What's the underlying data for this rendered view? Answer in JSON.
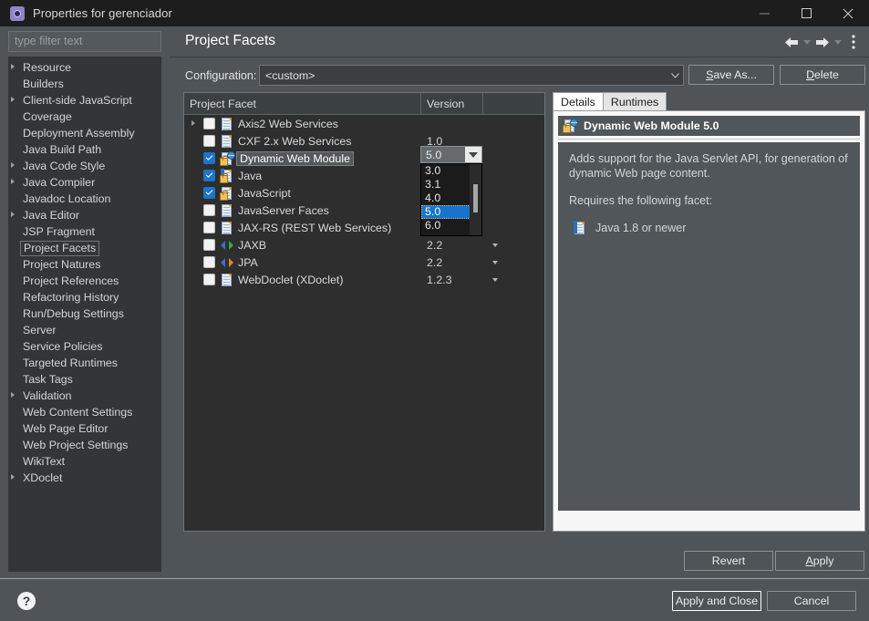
{
  "window": {
    "title": "Properties for gerenciador",
    "icon": "properties-gear-icon",
    "minimize": "—",
    "maximize": "□",
    "close": "✕"
  },
  "sidebar": {
    "filter_placeholder": "type filter text",
    "filter_value": "",
    "items": [
      {
        "label": "Resource",
        "expandable": true,
        "selected": false
      },
      {
        "label": "Builders",
        "expandable": false,
        "selected": false
      },
      {
        "label": "Client-side JavaScript",
        "expandable": true,
        "selected": false
      },
      {
        "label": "Coverage",
        "expandable": false,
        "selected": false
      },
      {
        "label": "Deployment Assembly",
        "expandable": false,
        "selected": false
      },
      {
        "label": "Java Build Path",
        "expandable": false,
        "selected": false
      },
      {
        "label": "Java Code Style",
        "expandable": true,
        "selected": false
      },
      {
        "label": "Java Compiler",
        "expandable": true,
        "selected": false
      },
      {
        "label": "Javadoc Location",
        "expandable": false,
        "selected": false
      },
      {
        "label": "Java Editor",
        "expandable": true,
        "selected": false
      },
      {
        "label": "JSP Fragment",
        "expandable": false,
        "selected": false
      },
      {
        "label": "Project Facets",
        "expandable": false,
        "selected": true
      },
      {
        "label": "Project Natures",
        "expandable": false,
        "selected": false
      },
      {
        "label": "Project References",
        "expandable": false,
        "selected": false
      },
      {
        "label": "Refactoring History",
        "expandable": false,
        "selected": false
      },
      {
        "label": "Run/Debug Settings",
        "expandable": false,
        "selected": false
      },
      {
        "label": "Server",
        "expandable": false,
        "selected": false
      },
      {
        "label": "Service Policies",
        "expandable": false,
        "selected": false
      },
      {
        "label": "Targeted Runtimes",
        "expandable": false,
        "selected": false
      },
      {
        "label": "Task Tags",
        "expandable": false,
        "selected": false
      },
      {
        "label": "Validation",
        "expandable": true,
        "selected": false
      },
      {
        "label": "Web Content Settings",
        "expandable": false,
        "selected": false
      },
      {
        "label": "Web Page Editor",
        "expandable": false,
        "selected": false
      },
      {
        "label": "Web Project Settings",
        "expandable": false,
        "selected": false
      },
      {
        "label": "WikiText",
        "expandable": false,
        "selected": false
      },
      {
        "label": "XDoclet",
        "expandable": true,
        "selected": false
      }
    ]
  },
  "page": {
    "title": "Project Facets",
    "tools": [
      {
        "name": "back-icon"
      },
      {
        "name": "back-dropdown-icon"
      },
      {
        "name": "forward-icon"
      },
      {
        "name": "forward-dropdown-icon"
      },
      {
        "name": "view-menu-icon"
      }
    ]
  },
  "configuration": {
    "label": "Configuration:",
    "value": "<custom>",
    "save_as_pre": "S",
    "save_as_post": "ave As...",
    "delete_pre": "D",
    "delete_post": "elete"
  },
  "facet_table": {
    "columns": [
      "Project Facet",
      "Version",
      ""
    ],
    "rows": [
      {
        "name": "Axis2 Web Services",
        "version": "",
        "checked": false,
        "expandable": true,
        "selected": false,
        "icon": "document-icon",
        "caret": false
      },
      {
        "name": "CXF 2.x Web Services",
        "version": "1.0",
        "checked": false,
        "expandable": false,
        "selected": false,
        "icon": "document-icon",
        "caret": false
      },
      {
        "name": "Dynamic Web Module",
        "version": "5.0",
        "checked": true,
        "expandable": false,
        "selected": true,
        "icon": "web-module-icon",
        "caret": false
      },
      {
        "name": "Java",
        "version": "",
        "checked": true,
        "expandable": false,
        "selected": false,
        "icon": "java-locked-icon",
        "caret": false
      },
      {
        "name": "JavaScript",
        "version": "",
        "checked": true,
        "expandable": false,
        "selected": false,
        "icon": "javascript-locked-icon",
        "caret": false
      },
      {
        "name": "JavaServer Faces",
        "version": "",
        "checked": false,
        "expandable": false,
        "selected": false,
        "icon": "document-icon",
        "caret": false
      },
      {
        "name": "JAX-RS (REST Web Services)",
        "version": "",
        "checked": false,
        "expandable": false,
        "selected": false,
        "icon": "document-icon",
        "caret": false
      },
      {
        "name": "JAXB",
        "version": "2.2",
        "checked": false,
        "expandable": false,
        "selected": false,
        "icon": "xml-arrows-icon",
        "caret": true
      },
      {
        "name": "JPA",
        "version": "2.2",
        "checked": false,
        "expandable": false,
        "selected": false,
        "icon": "xml-arrows-orange-icon",
        "caret": true
      },
      {
        "name": "WebDoclet (XDoclet)",
        "version": "1.2.3",
        "checked": false,
        "expandable": false,
        "selected": false,
        "icon": "document-icon",
        "caret": true
      }
    ]
  },
  "version_dropdown": {
    "open": true,
    "current": "5.0",
    "options": [
      "3.0",
      "3.1",
      "4.0",
      "5.0",
      "6.0"
    ],
    "selected": "5.0"
  },
  "details": {
    "tabs": [
      {
        "label": "Details",
        "active": true
      },
      {
        "label": "Runtimes",
        "active": false
      }
    ],
    "heading": "Dynamic Web Module 5.0",
    "heading_icon": "web-module-icon",
    "description": "Adds support for the Java Servlet API, for generation of dynamic Web page content.",
    "requires_label": "Requires the following facet:",
    "requirement": "Java 1.8 or newer",
    "requirement_icon": "java-icon"
  },
  "buttons": {
    "revert": "Revert",
    "apply_pre": "A",
    "apply_post": "pply",
    "apply_and_close": "Apply and Close",
    "cancel": "Cancel",
    "help_icon": "?"
  }
}
